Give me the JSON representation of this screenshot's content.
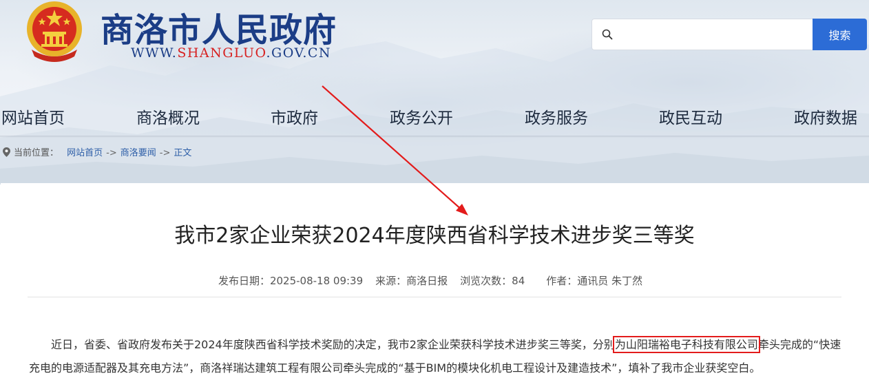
{
  "header": {
    "site_title": "商洛市人民政府",
    "url_prefix": "WWW.",
    "url_highlight": "SHANGLUO",
    "url_suffix": ".GOV.CN",
    "emblem_icon": "national-emblem-icon"
  },
  "search": {
    "placeholder": "",
    "value": "",
    "button_label": "搜索",
    "icon": "search-icon"
  },
  "nav": {
    "items": [
      {
        "label": "网站首页"
      },
      {
        "label": "商洛概况"
      },
      {
        "label": "市政府"
      },
      {
        "label": "政务公开"
      },
      {
        "label": "政务服务"
      },
      {
        "label": "政民互动"
      },
      {
        "label": "政府数据"
      }
    ]
  },
  "breadcrumb": {
    "prefix": "当前位置：",
    "items": [
      "网站首页",
      "商洛要闻",
      "正文"
    ],
    "separator": "->"
  },
  "article": {
    "title": "我市2家企业荣获2024年度陕西省科学技术进步奖三等奖",
    "meta": {
      "date": "发布日期：2025-08-18 09:39",
      "source": "来源：商洛日报",
      "views": "浏览次数：84",
      "author": "作者：通讯员 朱丁然"
    },
    "paragraph": {
      "part1": "近日，省委、省政府发布关于2024年度陕西省科学技术奖励的决定，我市2家企业荣获科学技术进步奖三等奖，分别",
      "highlight": "为山阳瑞裕电子科技有限公司",
      "part2": "牵头完成的“快速充电的电源适配器及其充电方法”，商洛祥瑞达建筑工程有限公司牵头完成的“基于BIM的模块化机电工程设计及建造技术”，填补了我市企业获奖空白。"
    }
  },
  "colors": {
    "brand_blue": "#1b3d86",
    "search_button": "#2c6cd6",
    "annotation_red": "#e31b1b",
    "url_red": "#d72222"
  }
}
